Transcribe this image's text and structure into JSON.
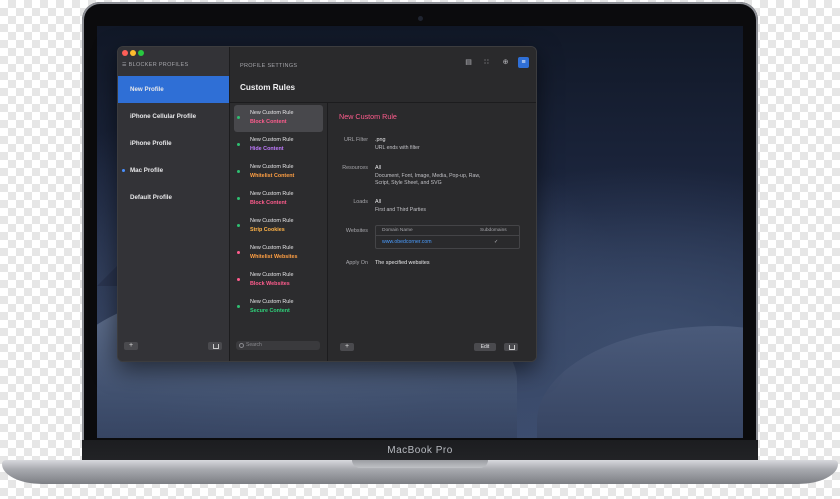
{
  "device": {
    "model_label": "MacBook Pro"
  },
  "sidebar": {
    "header": "BLOCKER PROFILES",
    "items": [
      {
        "label": "New Profile",
        "active": true
      },
      {
        "label": "iPhone Cellular Profile"
      },
      {
        "label": "iPhone Profile"
      },
      {
        "label": "Mac Profile",
        "indicator": "blue-dot"
      },
      {
        "label": "Default Profile"
      }
    ],
    "add_label": "+"
  },
  "settings": {
    "header": "PROFILE SETTINGS",
    "title": "Custom Rules",
    "toolbar_icons": [
      "list-icon",
      "grid-icon",
      "globe-icon",
      "document-icon"
    ]
  },
  "rules": [
    {
      "name": "New Custom Rule",
      "action": "Block Content",
      "dot_color": "#2fbf71",
      "action_color": "#ff5c8d"
    },
    {
      "name": "New Custom Rule",
      "action": "Hide Content",
      "dot_color": "#2fbf71",
      "action_color": "#c07bff"
    },
    {
      "name": "New Custom Rule",
      "action": "Whitelist Content",
      "dot_color": "#2fbf71",
      "action_color": "#ff9f43"
    },
    {
      "name": "New Custom Rule",
      "action": "Block Content",
      "dot_color": "#2fbf71",
      "action_color": "#ff5c8d"
    },
    {
      "name": "New Custom Rule",
      "action": "Strip Cookies",
      "dot_color": "#2fbf71",
      "action_color": "#ffb347"
    },
    {
      "name": "New Custom Rule",
      "action": "Whitelist Websites",
      "dot_color": "#ff5c8d",
      "action_color": "#ff9f43"
    },
    {
      "name": "New Custom Rule",
      "action": "Block Websites",
      "dot_color": "#ff5c8d",
      "action_color": "#ff5c8d"
    },
    {
      "name": "New Custom Rule",
      "action": "Secure Content",
      "dot_color": "#2fbf71",
      "action_color": "#2fd17a"
    }
  ],
  "search": {
    "placeholder": "Search"
  },
  "detail": {
    "title": "New Custom Rule",
    "url_filter_label": "URL Filter",
    "url_filter_value": ".png",
    "url_filter_desc": "URL ends with filter",
    "resources_label": "Resources",
    "resources_value": "All",
    "resources_desc_1": "Document, Font, Image, Media, Pop-up, Raw,",
    "resources_desc_2": "Script, Style Sheet, and SVG",
    "loads_label": "Loads",
    "loads_value": "All",
    "loads_desc": "First and Third Parties",
    "websites_label": "Websites",
    "websites_table": {
      "col_domain": "Domain Name",
      "col_subdomains": "Subdomains",
      "rows": [
        {
          "domain": "www.obedcorner.com",
          "subdomains": "✓"
        }
      ]
    },
    "apply_on_label": "Apply On",
    "apply_on_value": "The specified websites",
    "edit_label": "Edit",
    "add_label": "+"
  }
}
